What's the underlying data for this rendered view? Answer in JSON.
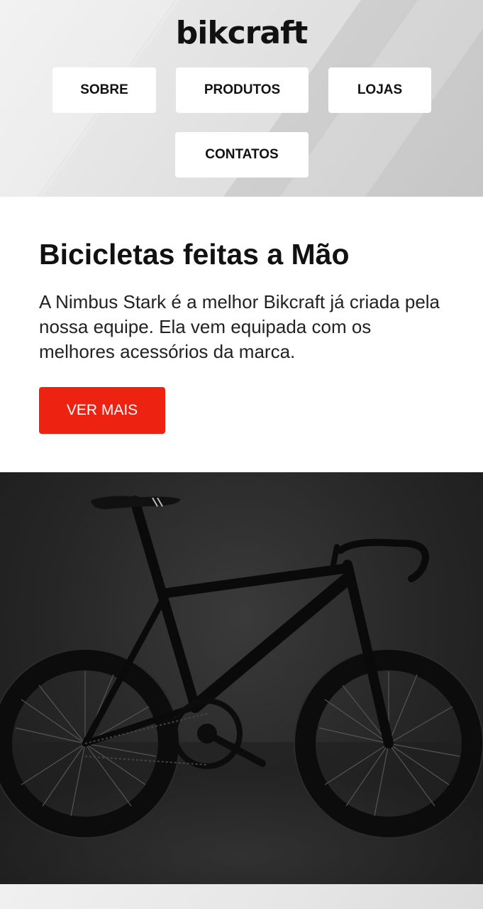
{
  "header": {
    "logo": "bikcraft",
    "nav": [
      {
        "label": "SOBRE"
      },
      {
        "label": "PRODUTOS"
      },
      {
        "label": "LOJAS"
      },
      {
        "label": "CONTATOS"
      }
    ]
  },
  "intro": {
    "title": "Bicicletas feitas a Mão",
    "description": "A Nimbus Stark é a melhor Bikcraft já criada pela nossa equipe. Ela vem equipada com os melhores acessórios da marca.",
    "button_label": "VER MAIS"
  },
  "hero": {
    "image": "road-bicycle-photo"
  },
  "colors": {
    "accent": "#ee2211",
    "text": "#111111",
    "hero_background": "#262626"
  }
}
